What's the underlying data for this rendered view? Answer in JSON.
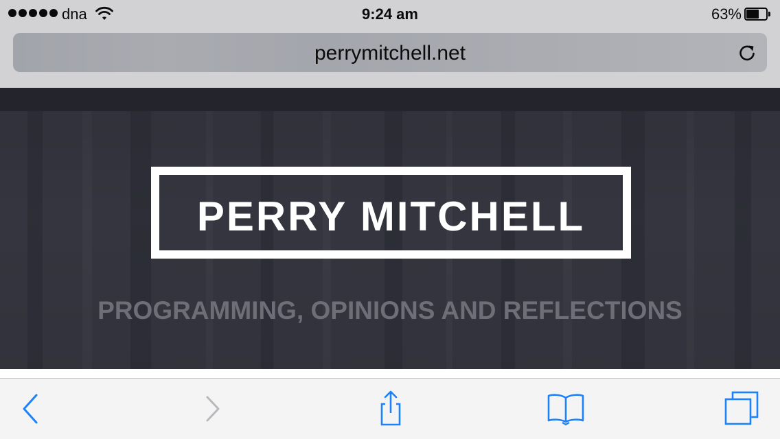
{
  "status_bar": {
    "carrier": "dna",
    "time": "9:24 am",
    "battery_percent": "63%",
    "battery_level": 0.63,
    "signal_bars": 5
  },
  "address_bar": {
    "url": "perrymitchell.net"
  },
  "page": {
    "logo_text": "PERRY MITCHELL",
    "tagline": "PROGRAMMING, OPINIONS AND REFLECTIONS"
  },
  "toolbar": {
    "back_icon": "chevron-left-icon",
    "forward_icon": "chevron-right-icon",
    "share_icon": "share-icon",
    "bookmarks_icon": "book-icon",
    "tabs_icon": "tabs-icon",
    "back_enabled": true,
    "forward_enabled": false
  },
  "colors": {
    "accent": "#1a82fb",
    "disabled": "#b9b9bd",
    "hero_bg": "#35363f"
  }
}
